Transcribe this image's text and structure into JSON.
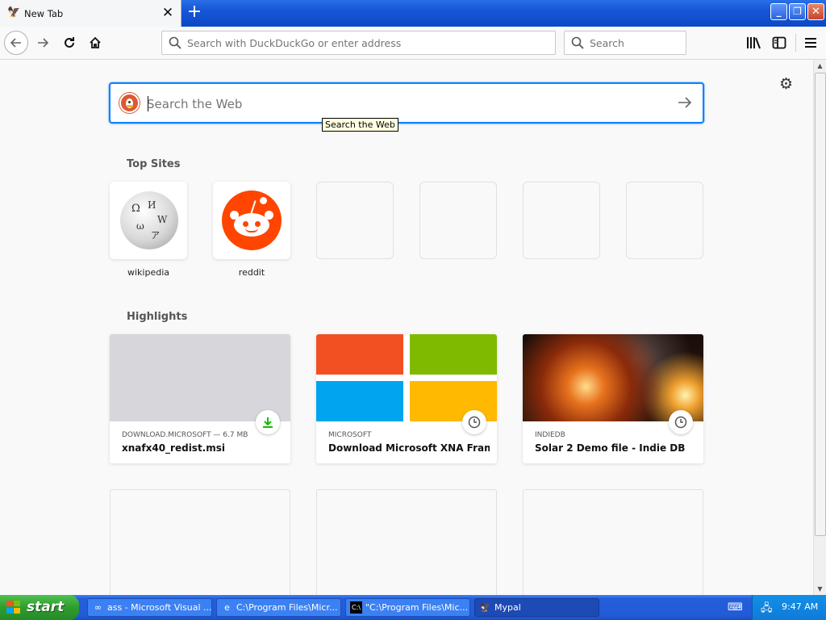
{
  "browser": {
    "tab": {
      "title": "New Tab",
      "close": "✕"
    },
    "new_tab_label": "+",
    "window_controls": {
      "minimize": "_",
      "maximize": "❐",
      "close": "✕"
    },
    "url_placeholder": "Search with DuckDuckGo or enter address",
    "search_placeholder": "Search",
    "icons": [
      "back-icon",
      "forward-icon",
      "reload-icon",
      "home-icon",
      "library-icon",
      "sidebar-icon",
      "menu-icon",
      "gear-icon"
    ]
  },
  "newtab": {
    "search": {
      "placeholder": "Search the Web",
      "tooltip": "Search the Web",
      "accent": "#0a84ff"
    },
    "top_sites_title": "Top Sites",
    "top_sites": [
      {
        "label": "wikipedia"
      },
      {
        "label": "reddit"
      },
      {
        "label": ""
      },
      {
        "label": ""
      },
      {
        "label": ""
      },
      {
        "label": ""
      }
    ],
    "highlights_title": "Highlights",
    "highlights": [
      {
        "source": "DOWNLOAD.MICROSOFT — 6.7 MB",
        "title": "xnafx40_redist.msi",
        "badge": "download-icon"
      },
      {
        "source": "MICROSOFT",
        "title": "Download Microsoft XNA Frame...",
        "badge": "clock-icon"
      },
      {
        "source": "INDIEDB",
        "title": "Solar 2 Demo file - Indie DB",
        "badge": "clock-icon"
      }
    ]
  },
  "taskbar": {
    "start_label": "start",
    "tasks": [
      {
        "label": "ass - Microsoft Visual ..."
      },
      {
        "label": "C:\\Program Files\\Micr..."
      },
      {
        "label": "\"C:\\Program Files\\Mic..."
      },
      {
        "label": "Mypal"
      }
    ],
    "clock": "9:47 AM"
  }
}
